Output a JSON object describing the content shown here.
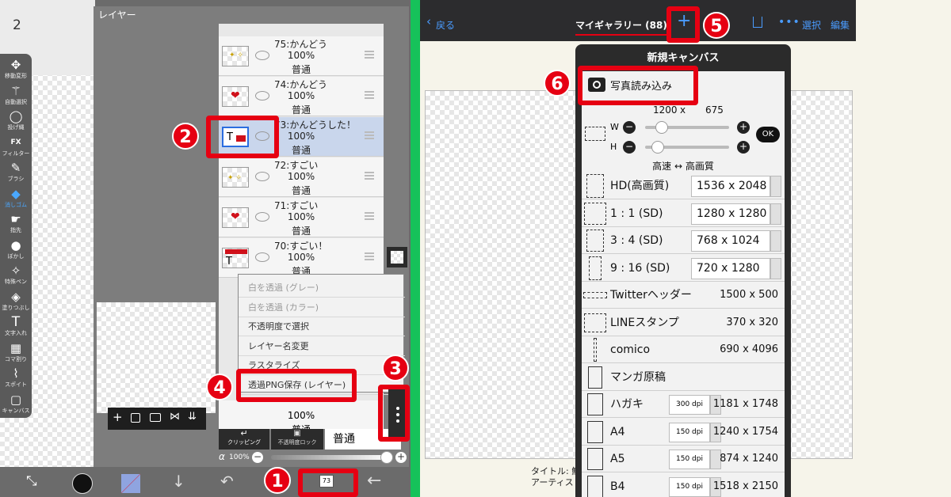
{
  "left": {
    "page_number": "2",
    "panel_title": "レイヤー",
    "tools": [
      {
        "label": "移動変形",
        "icon": "move-icon"
      },
      {
        "label": "自動選択",
        "icon": "magic-wand-icon"
      },
      {
        "label": "投げ縄",
        "icon": "lasso-icon"
      },
      {
        "label": "フィルター",
        "icon": "fx-icon"
      },
      {
        "label": "ブラシ",
        "icon": "brush-icon"
      },
      {
        "label": "消しゴム",
        "icon": "eraser-icon"
      },
      {
        "label": "指先",
        "icon": "finger-icon"
      },
      {
        "label": "ぼかし",
        "icon": "blur-icon"
      },
      {
        "label": "特殊ペン",
        "icon": "special-pen-icon"
      },
      {
        "label": "塗りつぶし",
        "icon": "fill-icon"
      },
      {
        "label": "文字入れ",
        "icon": "text-icon"
      },
      {
        "label": "コマ割り",
        "icon": "frame-icon"
      },
      {
        "label": "スポイト",
        "icon": "eyedropper-icon"
      },
      {
        "label": "キャンバス",
        "icon": "canvas-icon"
      }
    ],
    "fx_text": "FX",
    "text_tool_glyph": "T",
    "layers": [
      {
        "name": "75:かんどう",
        "opacity": "100%",
        "mode": "普通"
      },
      {
        "name": "74:かんどう",
        "opacity": "100%",
        "mode": "普通"
      },
      {
        "name": "73:かんどうした！",
        "opacity": "100%",
        "mode": "普通"
      },
      {
        "name": "72:すごい",
        "opacity": "100%",
        "mode": "普通"
      },
      {
        "name": "71:すごい",
        "opacity": "100%",
        "mode": "普通"
      },
      {
        "name": "70:すごい！",
        "opacity": "100%",
        "mode": "普通"
      }
    ],
    "partial_layer": {
      "opacity": "100%",
      "mode": "普通"
    },
    "context_menu": [
      {
        "label": "白を透過 (グレー)",
        "enabled": false
      },
      {
        "label": "白を透過 (カラー)",
        "enabled": false
      },
      {
        "label": "不透明度で選択",
        "enabled": true
      },
      {
        "label": "レイヤー名変更",
        "enabled": true
      },
      {
        "label": "ラスタライズ",
        "enabled": true
      },
      {
        "label": "透過PNG保存 (レイヤー)",
        "enabled": true
      }
    ],
    "clipping_label": "クリッピング",
    "opacity_lock_label": "不透明度ロック",
    "blend_mode": "普通",
    "alpha_symbol": "α",
    "alpha_value": "100%",
    "alpha_fraction": 1.0,
    "layer_count_badge": "73",
    "layer_buttons": [
      "add-layer-icon",
      "add-fill-layer-icon",
      "camera-icon",
      "flip-icon",
      "merge-down-icon"
    ],
    "bottom_icons": [
      "transform-icon",
      "color-icon",
      "secondary-color-icon",
      "download-icon",
      "undo-icon",
      "layers-icon",
      "back-icon"
    ],
    "thumb_text_73": "T",
    "thumb_text_70": "T"
  },
  "right": {
    "back_label": "戻る",
    "gallery_title": "マイギャラリー (88)",
    "plus_glyph": "+",
    "select_label": "選択",
    "edit_label": "編集",
    "dialog_title": "新規キャンバス",
    "import_photo": "写真読み込み",
    "custom_w": "1200",
    "custom_x": "x",
    "custom_h": "675",
    "w_label": "W",
    "h_label": "H",
    "w_slider": 0.12,
    "h_slider": 0.08,
    "ok_label": "OK",
    "quality_label": "高速 ↔ 高画質",
    "presets": [
      {
        "label": "HD(高画質)",
        "size": "1536 x 2048",
        "type": "field"
      },
      {
        "label": "1 : 1 (SD)",
        "size": "1280 x 1280",
        "type": "field"
      },
      {
        "label": "3 : 4 (SD)",
        "size": "768 x 1024",
        "type": "field"
      },
      {
        "label": "9 : 16 (SD)",
        "size": "720 x 1280",
        "type": "field"
      },
      {
        "label": "Twitterヘッダー",
        "size": "1500 x 500",
        "type": "text"
      },
      {
        "label": "LINEスタンプ",
        "size": "370 x 320",
        "type": "text"
      },
      {
        "label": "comico",
        "size": "690 x 4096",
        "type": "text"
      },
      {
        "label": "マンガ原稿",
        "size": "",
        "type": "text"
      },
      {
        "label": "ハガキ",
        "size": "1181 x 1748",
        "type": "dpi",
        "dpi": "300 dpi"
      },
      {
        "label": "A4",
        "size": "1240 x 1754",
        "type": "dpi",
        "dpi": "150 dpi"
      },
      {
        "label": "A5",
        "size": "874 x 1240",
        "type": "dpi",
        "dpi": "150 dpi"
      },
      {
        "label": "B4",
        "size": "1518 x 2150",
        "type": "dpi",
        "dpi": "150 dpi"
      }
    ],
    "title_caption": "タイトル: 鮮",
    "artist_caption": "アーティス"
  },
  "badges": [
    "1",
    "2",
    "3",
    "4",
    "5",
    "6"
  ],
  "colors": {
    "highlight": "#e60012",
    "divider": "#16c25a",
    "selection": "#c9d6ec",
    "tool_active": "#4aa8ff"
  }
}
